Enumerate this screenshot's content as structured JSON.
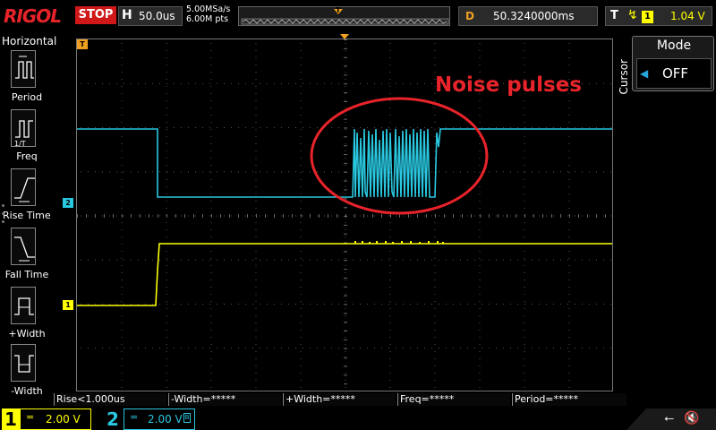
{
  "top_bar": {
    "logo": "RIGOL",
    "run_status": "STOP",
    "horizontal": {
      "label": "H",
      "timebase": "50.0us"
    },
    "sample_rate": "5.00MSa/s",
    "memory_depth": "6.00M pts",
    "trigger_position_marker": "T",
    "delay": {
      "label": "D",
      "value": "50.3240000ms"
    },
    "trigger": {
      "label": "T",
      "edge": "rising",
      "source": "1",
      "level": "1.04 V"
    }
  },
  "left_menu": {
    "title": "Horizontal",
    "items": [
      {
        "label": "Period",
        "icon": "period-icon"
      },
      {
        "label": "Freq",
        "icon": "frequency-icon"
      },
      {
        "label": "Rise Time",
        "icon": "rise-time-icon"
      },
      {
        "label": "Fall Time",
        "icon": "fall-time-icon"
      },
      {
        "label": "+Width",
        "icon": "positive-width-icon"
      },
      {
        "label": "-Width",
        "icon": "negative-width-icon"
      }
    ]
  },
  "screen": {
    "annotation": "Noise pulses",
    "markers": {
      "ch1": "1",
      "ch2": "2",
      "trigger_left": "T",
      "trigger_right": "T"
    }
  },
  "cursor_panel": {
    "side_label": "Cursor",
    "mode_title": "Mode",
    "mode_value": "OFF"
  },
  "measurements": [
    "Rise<1.000us",
    "-Width=*****",
    "+Width=*****",
    "Freq=*****",
    "Period=*****"
  ],
  "channels": {
    "ch1": {
      "number": "1",
      "coupling": "=",
      "scale": "2.00 V",
      "color": "#ffff00"
    },
    "ch2": {
      "number": "2",
      "coupling": "=",
      "scale": "2.00 V",
      "color": "#29c8e0"
    }
  },
  "colors": {
    "ch1": "#ffff00",
    "ch2": "#29c8e0",
    "trigger": "#f0a020",
    "annotation": "#e8232a"
  }
}
